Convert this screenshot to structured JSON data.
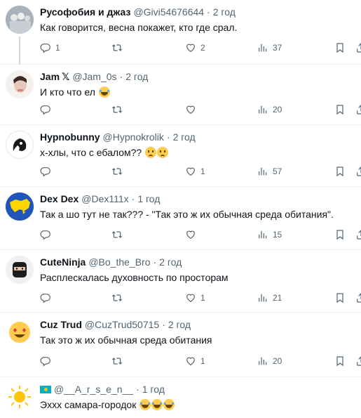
{
  "tweets": [
    {
      "name": "Русофобия и джаз",
      "handle": "@Givi54676644",
      "dot": "·",
      "time": "2 год",
      "text": "Как говорится, весна покажет, кто где срал.",
      "replies": "1",
      "retweets": "",
      "likes": "2",
      "views": "37"
    },
    {
      "name": "Jam",
      "badge": "𝕏",
      "handle": "@Jam_0s",
      "dot": "·",
      "time": "2 год",
      "text": "И кто что ел",
      "emojis": [
        "face-with-tears-of-joy"
      ],
      "replies": "",
      "retweets": "",
      "likes": "",
      "views": "20"
    },
    {
      "name": "Hypnobunny",
      "handle": "@Hypnokrolik",
      "dot": "·",
      "time": "2 год",
      "text": "х-хлы, что с ебалом??",
      "emojis": [
        "worried-face",
        "worried-face"
      ],
      "replies": "",
      "retweets": "",
      "likes": "1",
      "views": "57"
    },
    {
      "name": "Dex Dex",
      "handle": "@Dex111x",
      "dot": "·",
      "time": "1 год",
      "text": "Так а шо тут не так??? - \"Так это ж их обычная среда обитания\".",
      "replies": "",
      "retweets": "",
      "likes": "",
      "views": "15"
    },
    {
      "name": "CuteNinja",
      "handle": "@Bo_the_Bro",
      "dot": "·",
      "time": "2 год",
      "text": "Расплескалась духовность по просторам",
      "replies": "",
      "retweets": "",
      "likes": "1",
      "views": "21"
    },
    {
      "name": "Cuz Trud",
      "handle": "@CuzTrud50715",
      "dot": "·",
      "time": "2 год",
      "text": "Так это ж их обычная среда обитания",
      "replies": "",
      "retweets": "",
      "likes": "1",
      "views": "20"
    },
    {
      "name": "@__A_r_s_e_n__",
      "handle": "",
      "dot": "·",
      "time": "1 год",
      "text": "Эххх самара-городок",
      "emojis": [
        "face-with-tears-of-joy",
        "face-with-tears-of-joy",
        "face-with-tears-of-joy"
      ]
    }
  ],
  "icons": {
    "reply": "reply-icon",
    "retweet": "retweet-icon",
    "like": "heart-icon",
    "views": "views-icon",
    "bookmark": "bookmark-icon",
    "share": "share-icon"
  },
  "colors": {
    "text": "#0f1419",
    "secondary": "#536471",
    "divider": "#eff3f4"
  }
}
